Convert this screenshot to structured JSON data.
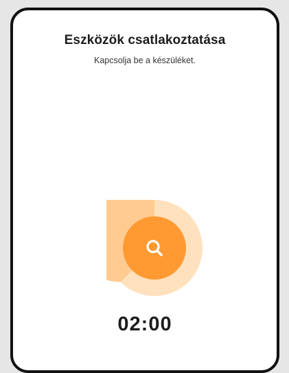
{
  "dialog": {
    "title": "Eszközök csatlakoztatása",
    "subtitle": "Kapcsolja be a készüléket."
  },
  "scan": {
    "icon": "search-icon",
    "accent_color": "#ff9a33",
    "ring_color": "#ffd7a8",
    "ring_progress_color": "#ffc481"
  },
  "timer": {
    "value": "02:00"
  }
}
